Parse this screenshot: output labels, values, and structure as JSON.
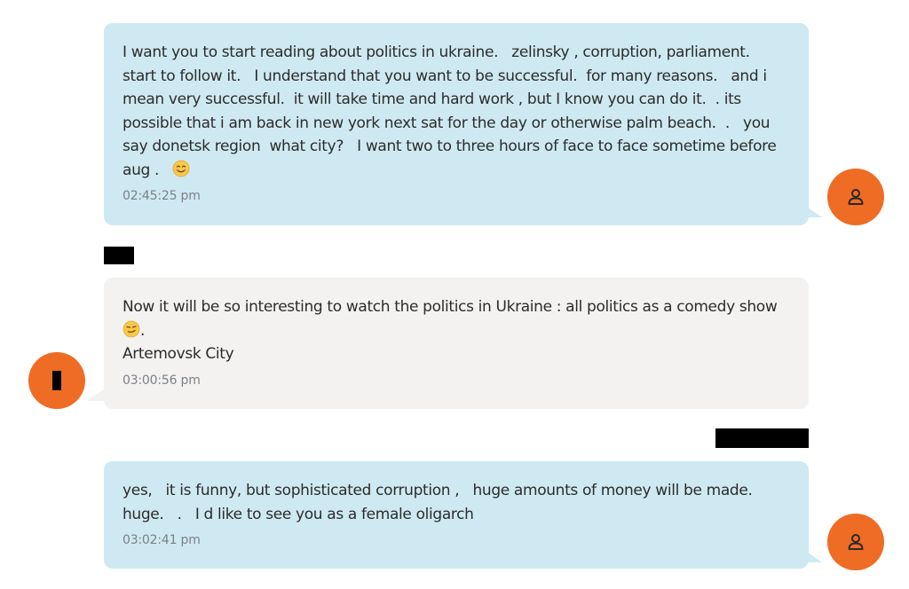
{
  "messages": [
    {
      "direction": "outgoing",
      "text": "I want you to start reading about politics in ukraine.   zelinsky , corruption, parliament.  start to follow it.   I understand that you want to be successful.  for many reasons.   and i mean very successful.  it will take time and hard work , but I know you can do it.  . its possible that i am back in new york next sat for the day or otherwise palm beach.  .   you say donetsk region  what city?   I want two to three hours of face to face sometime before aug .   ",
      "emoji": "smiling-face-emoji",
      "time": "02:45:25 pm"
    },
    {
      "direction": "incoming",
      "text": "Now it will be so interesting to watch the politics in Ukraine : all politics as a comedy show ",
      "emoji": "smirking-face-emoji",
      "text_after": ".\nArtemovsk City",
      "time": "03:00:56 pm"
    },
    {
      "direction": "outgoing",
      "text": "yes,   it is funny, but sophisticated corruption ,   huge amounts of money will be made.  huge.   .   I d like to see you as a female oligarch",
      "time": "03:02:41 pm"
    }
  ],
  "colors": {
    "outgoing_bubble": "#cfe9f2",
    "incoming_bubble": "#f4f2f1",
    "avatar": "#ef6c25",
    "timestamp": "#7c8087",
    "redaction": "#000000"
  },
  "icons": {
    "outgoing_avatar": "user-icon",
    "incoming_avatar": "redacted-avatar"
  }
}
